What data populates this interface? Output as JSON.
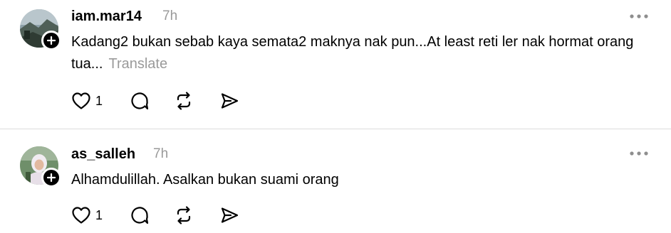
{
  "posts": [
    {
      "username": "iam.mar14",
      "time": "7h",
      "text": "Kadang2 bukan sebab kaya semata2 maknya nak pun...At least reti ler nak hormat orang tua...",
      "translate_label": "Translate",
      "like_count": "1",
      "avatar_icon": "avatar-landscape-photo",
      "follow_icon": "plus-icon",
      "more_icon": "more-horizontal-icon"
    },
    {
      "username": "as_salleh",
      "time": "7h",
      "text": "Alhamdulillah. Asalkan bukan suami orang",
      "like_count": "1",
      "avatar_icon": "avatar-person-photo",
      "follow_icon": "plus-icon",
      "more_icon": "more-horizontal-icon"
    }
  ],
  "icons": {
    "like": "heart-icon",
    "comment": "comment-icon",
    "repost": "repost-icon",
    "share": "send-icon"
  },
  "colors": {
    "text": "#000000",
    "muted": "#9a9a9a",
    "divider": "#dcdcdc"
  }
}
